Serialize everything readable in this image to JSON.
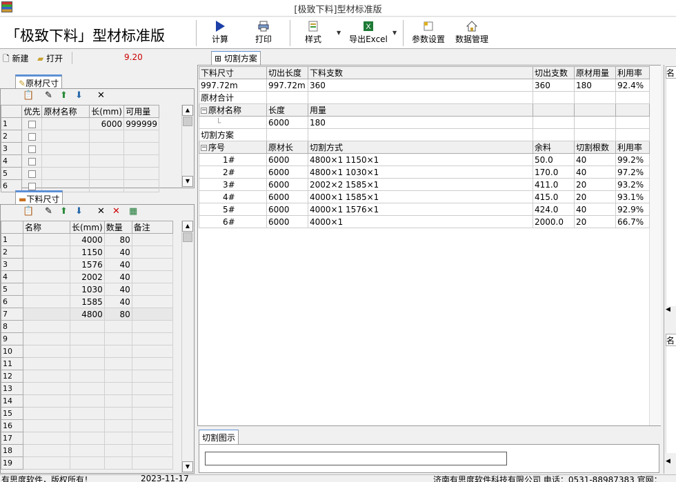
{
  "window": {
    "title": "[极致下料]型材标准版"
  },
  "app_title": "「极致下料」型材标准版",
  "toolbar": {
    "calc": "计算",
    "print": "打印",
    "style": "样式",
    "export": "导出Excel",
    "params": "参数设置",
    "data_mgmt": "数据管理"
  },
  "subtool": {
    "new": "新建",
    "open": "打开",
    "version": "9.20"
  },
  "raw": {
    "tab": "原材尺寸",
    "headers": [
      "优先",
      "原材名称",
      "长(mm)",
      "可用量"
    ],
    "rows": [
      {
        "n": "1",
        "len": "6000",
        "qty": "999999"
      },
      {
        "n": "2"
      },
      {
        "n": "3"
      },
      {
        "n": "4"
      },
      {
        "n": "5"
      },
      {
        "n": "6"
      }
    ]
  },
  "parts": {
    "tab": "下料尺寸",
    "headers": [
      "名称",
      "长(mm)",
      "数量",
      "备注"
    ],
    "rows": [
      {
        "n": "1",
        "len": "4000",
        "qty": "80"
      },
      {
        "n": "2",
        "len": "1150",
        "qty": "40"
      },
      {
        "n": "3",
        "len": "1576",
        "qty": "40"
      },
      {
        "n": "4",
        "len": "2002",
        "qty": "40"
      },
      {
        "n": "5",
        "len": "1030",
        "qty": "40"
      },
      {
        "n": "6",
        "len": "1585",
        "qty": "40"
      },
      {
        "n": "7",
        "len": "4800",
        "qty": "80"
      },
      {
        "n": "8"
      },
      {
        "n": "9"
      },
      {
        "n": "10"
      },
      {
        "n": "11"
      },
      {
        "n": "12"
      },
      {
        "n": "13"
      },
      {
        "n": "14"
      },
      {
        "n": "15"
      },
      {
        "n": "16"
      },
      {
        "n": "17"
      },
      {
        "n": "18"
      },
      {
        "n": "19"
      }
    ]
  },
  "plan": {
    "tab": "切割方案",
    "summary_headers": [
      "下料尺寸",
      "切出长度",
      "下料支数",
      "切出支数",
      "原材用量",
      "利用率"
    ],
    "summary_row": [
      "997.72m",
      "997.72m",
      "360",
      "360",
      "180",
      "92.4%"
    ],
    "raw_total": "原材合计",
    "raw_headers": [
      "原材名称",
      "长度",
      "用量"
    ],
    "raw_row": [
      "6000",
      "180"
    ],
    "plan_title": "切割方案",
    "plan_headers": [
      "序号",
      "原材长",
      "切割方式",
      "余料",
      "切割根数",
      "利用率"
    ],
    "plan_rows": [
      [
        "1#",
        "6000",
        "4800×1 1150×1",
        "50.0",
        "40",
        "99.2%"
      ],
      [
        "2#",
        "6000",
        "4800×1 1030×1",
        "170.0",
        "40",
        "97.2%"
      ],
      [
        "3#",
        "6000",
        "2002×2 1585×1",
        "411.0",
        "20",
        "93.2%"
      ],
      [
        "4#",
        "6000",
        "4000×1 1585×1",
        "415.0",
        "20",
        "93.1%"
      ],
      [
        "5#",
        "6000",
        "4000×1 1576×1",
        "424.0",
        "40",
        "92.9%"
      ],
      [
        "6#",
        "6000",
        "4000×1",
        "2000.0",
        "20",
        "66.7%"
      ]
    ]
  },
  "diagram": {
    "tab": "切割图示"
  },
  "right": {
    "col": "名"
  },
  "status": {
    "left": "有思度软件，版权所有！",
    "date": "2023-11-17",
    "right": "济南有思度软件科技有限公司 电话：0531-88987383 官网："
  },
  "colors": {
    "accent": "#5b8fd6",
    "header_bg": "#f0f0f0",
    "version": "#cc0000"
  }
}
